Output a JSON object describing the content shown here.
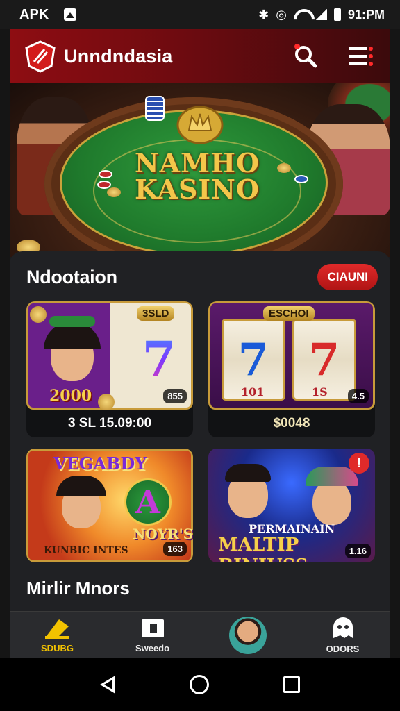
{
  "status_bar": {
    "carrier": "APK",
    "time": "91:PM"
  },
  "header": {
    "brand": "Unndndasia"
  },
  "hero": {
    "title_line1": "NAMHO",
    "title_line2": "KASINO"
  },
  "section": {
    "title": "Ndootaion",
    "pill_label": "CIAUNI"
  },
  "games": [
    {
      "badge": "3SLD",
      "jackpot": "2000",
      "count": "855",
      "label": "3 SL 15.09:00"
    },
    {
      "badge": "ESCHOI",
      "reel_left": "7",
      "reel_right": "7",
      "reel_left_sub": "101",
      "reel_right_sub": "1S",
      "count": "4.5",
      "label": "$0048"
    },
    {
      "banner": "VEGABDY",
      "big_letter": "A",
      "script": "NOYR'S",
      "footer": "KUNBIC INTES",
      "count": "163",
      "label": ""
    },
    {
      "overline": "PERMAINAIN",
      "headline": "MALTIP BINIUSS",
      "count": "1.16",
      "label": ""
    }
  ],
  "more": {
    "title": "Mirlir Mnors"
  },
  "bottom_nav": [
    {
      "label": "SDUBG"
    },
    {
      "label": "Sweedo"
    },
    {
      "label": ""
    },
    {
      "label": "ODORS"
    }
  ],
  "colors": {
    "brand_red": "#8e0d12",
    "accent_red": "#e02a2a",
    "gold": "#f3c64a",
    "active_nav": "#f2c200"
  }
}
